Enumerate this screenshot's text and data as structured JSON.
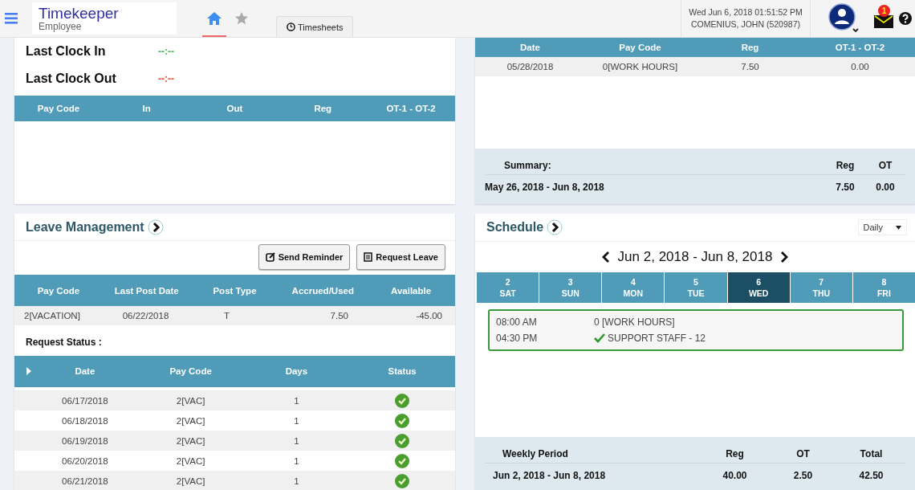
{
  "header": {
    "app_title": "Timekeeper",
    "app_subtitle": "Employee",
    "tabs": [
      {
        "kind": "home",
        "selected": true
      },
      {
        "kind": "star",
        "selected": false
      },
      {
        "kind": "timesheets",
        "label": "Timesheets",
        "selected": false
      }
    ],
    "datetime": "Wed Jun 6, 2018 01:51:52 PM",
    "user": "COMENIUS, JOHN (520987)",
    "notification_count": "1"
  },
  "clock": [
    {
      "kind": "in",
      "label": "Last Clock In",
      "value": "--:--"
    },
    {
      "kind": "out",
      "label": "Last Clock Out",
      "value": "--:--"
    }
  ],
  "punch_table": {
    "columns": [
      "Pay Code",
      "In",
      "Out",
      "Reg",
      "OT-1 - OT-2"
    ]
  },
  "timecard": {
    "columns": [
      "Date",
      "Pay Code",
      "Reg",
      "OT-1 - OT-2"
    ],
    "rows": [
      [
        "05/28/2018",
        "0[WORK HOURS]",
        "7.50",
        "0.00"
      ]
    ],
    "summary": {
      "title": "Summary:",
      "columns": [
        "Reg",
        "OT"
      ],
      "period": "May 26, 2018 - Jun 8, 2018",
      "values": [
        "7.50",
        "0.00"
      ]
    }
  },
  "leave": {
    "title": "Leave Management",
    "buttons": [
      {
        "kind": "reminder",
        "label": "Send Reminder"
      },
      {
        "kind": "request",
        "label": "Request Leave"
      }
    ],
    "balance_columns": [
      "Pay Code",
      "Last Post Date",
      "Post Type",
      "Accrued/Used",
      "Available"
    ],
    "balance_rows": [
      [
        "2[VACATION]",
        "06/22/2018",
        "T",
        "7.50",
        "-45.00"
      ]
    ],
    "request_status_label": "Request Status :",
    "request_columns": [
      "Date",
      "Pay Code",
      "Days",
      "Status"
    ],
    "requests": [
      {
        "date": "06/17/2018",
        "pay_code": "2[VAC]",
        "days": "1",
        "approved": true
      },
      {
        "date": "06/18/2018",
        "pay_code": "2[VAC]",
        "days": "1",
        "approved": true
      },
      {
        "date": "06/19/2018",
        "pay_code": "2[VAC]",
        "days": "1",
        "approved": true
      },
      {
        "date": "06/20/2018",
        "pay_code": "2[VAC]",
        "days": "1",
        "approved": true
      },
      {
        "date": "06/21/2018",
        "pay_code": "2[VAC]",
        "days": "1",
        "approved": true
      }
    ]
  },
  "schedule": {
    "title": "Schedule",
    "view": "Daily",
    "range": "Jun 2, 2018 - Jun 8, 2018",
    "days": [
      {
        "num": "2",
        "name": "SAT",
        "selected": false
      },
      {
        "num": "3",
        "name": "SUN",
        "selected": false
      },
      {
        "num": "4",
        "name": "MON",
        "selected": false
      },
      {
        "num": "5",
        "name": "TUE",
        "selected": false
      },
      {
        "num": "6",
        "name": "WED",
        "selected": true
      },
      {
        "num": "7",
        "name": "THU",
        "selected": false
      },
      {
        "num": "8",
        "name": "FRI",
        "selected": false
      }
    ],
    "entries": [
      {
        "time": "08:00 AM",
        "text": "0 [WORK HOURS]",
        "checked": false
      },
      {
        "time": "04:30 PM",
        "text": "SUPPORT STAFF - 12",
        "checked": true
      }
    ],
    "weekly": {
      "columns": [
        "Weekly Period",
        "Reg",
        "OT",
        "Total"
      ],
      "values": [
        "Jun 2, 2018 - Jun 8, 2018",
        "40.00",
        "2.50",
        "42.50"
      ]
    }
  }
}
